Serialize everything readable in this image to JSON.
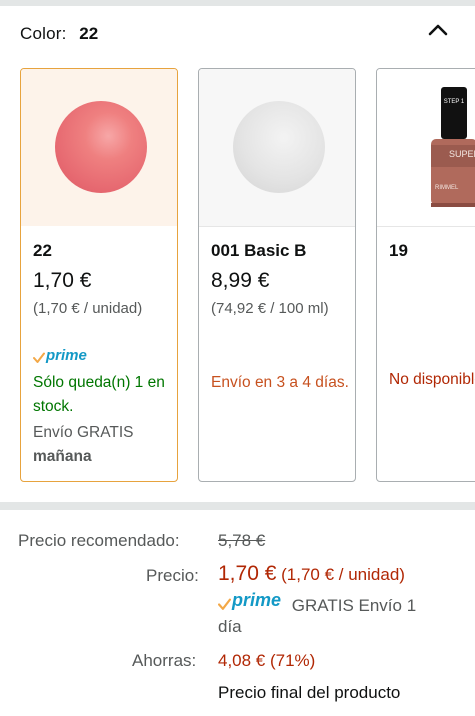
{
  "variation": {
    "label": "Color:",
    "selected_value": "22",
    "collapse_icon": "chevron-up-icon"
  },
  "swatches": [
    {
      "name": "22",
      "price": "1,70 €",
      "unit_price": "(1,70 € / unidad)",
      "prime_label": "prime",
      "availability": "Sólo queda(n) 1 en stock.",
      "shipping": "Envío GRATIS",
      "delivery_day": "mañana",
      "color": "#e66870"
    },
    {
      "name": "001 Basic B",
      "price": "8,99 €",
      "unit_price": "(74,92 € / 100 ml)",
      "delivery": "Envío en 3 a 4 días.",
      "color": "#e0e0e0"
    },
    {
      "name": "19",
      "availability": "No disponible",
      "bottle_cap_text": "STEP 1",
      "bottle_label": "SUPER Gel",
      "bottle_brand": "RIMMEL",
      "color": "#b06a5c"
    }
  ],
  "pricing": {
    "list_price_label": "Precio recomendado:",
    "list_price": "5,78 €",
    "price_label": "Precio:",
    "price": "1,70 €",
    "unit_price": "(1,70 € / unidad)",
    "prime_label": "prime",
    "prime_shipping_line1": "GRATIS Envío 1",
    "prime_shipping_line2": "día",
    "savings_label": "Ahorras:",
    "savings": "4,08 € (71%)",
    "final_price_note": "Precio final del producto"
  },
  "colors": {
    "price_red": "#B12704",
    "stock_green": "#007600",
    "ship_orange": "#C7511F",
    "prime_blue": "#1399c6",
    "selected_border": "#e7a33e"
  }
}
